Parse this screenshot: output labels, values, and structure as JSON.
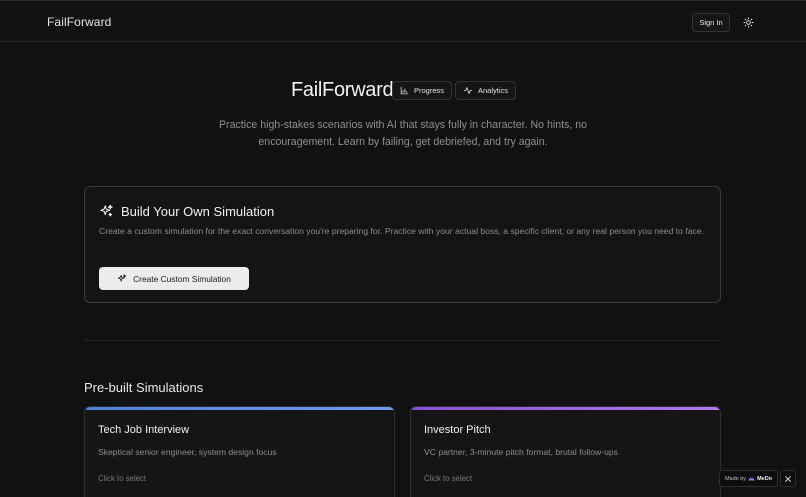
{
  "nav": {
    "brand": "FailForward",
    "signin_label": "Sign In",
    "theme_icon": "sun-icon"
  },
  "hero": {
    "title": "FailForward",
    "pills": [
      {
        "label": "Progress",
        "icon": "bar-chart-icon"
      },
      {
        "label": "Analytics",
        "icon": "activity-icon"
      }
    ],
    "subtitle": "Practice high-stakes scenarios with AI that stays fully in character. No hints, no encouragement. Learn by failing, get debriefed, and try again."
  },
  "builder": {
    "icon": "sparkles-icon",
    "title": "Build Your Own Simulation",
    "description": "Create a custom simulation for the exact conversation you're preparing for. Practice with your actual boss, a specific client, or any real person you need to face.",
    "button_label": "Create Custom Simulation"
  },
  "prebuilt": {
    "section_title": "Pre-built Simulations",
    "cards": [
      {
        "title": "Tech Job Interview",
        "description": "Skeptical senior engineer, system design focus",
        "hint": "Click to select",
        "accent": "#5b8def"
      },
      {
        "title": "Investor Pitch",
        "description": "VC partner, 3-minute pitch format, brutal follow-ups",
        "hint": "Click to select",
        "accent": "#9b5de5"
      }
    ]
  },
  "badge": {
    "prefix": "Made by",
    "brand": "MeDo",
    "close_icon": "close-icon"
  },
  "colors": {
    "background": "#111111",
    "panel": "#141414",
    "border": "#3a3a3a",
    "button_light": "#ececec"
  }
}
